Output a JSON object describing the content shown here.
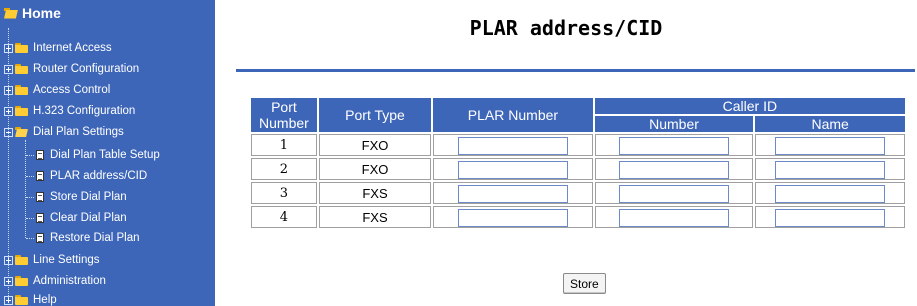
{
  "sidebar": {
    "home_label": "Home",
    "items": [
      {
        "label": "Internet Access"
      },
      {
        "label": "Router Configuration"
      },
      {
        "label": "Access Control"
      },
      {
        "label": "H.323 Configuration"
      },
      {
        "label": "Dial Plan Settings"
      },
      {
        "label": "Dial Plan Table Setup"
      },
      {
        "label": "PLAR address/CID"
      },
      {
        "label": "Store Dial Plan"
      },
      {
        "label": "Clear Dial Plan"
      },
      {
        "label": "Restore Dial Plan"
      },
      {
        "label": "Line Settings"
      },
      {
        "label": "Administration"
      },
      {
        "label": "Help"
      }
    ]
  },
  "main": {
    "title": "PLAR address/CID",
    "table": {
      "headers": {
        "port_line1": "Port",
        "port_line2": "Number",
        "port_type": "Port Type",
        "plar_number": "PLAR Number",
        "caller_id": "Caller ID",
        "cid_number": "Number",
        "cid_name": "Name"
      },
      "rows": [
        {
          "port": "1",
          "type": "FXO",
          "plar": "",
          "cid_number": "",
          "cid_name": ""
        },
        {
          "port": "2",
          "type": "FXO",
          "plar": "",
          "cid_number": "",
          "cid_name": ""
        },
        {
          "port": "3",
          "type": "FXS",
          "plar": "",
          "cid_number": "",
          "cid_name": ""
        },
        {
          "port": "4",
          "type": "FXS",
          "plar": "",
          "cid_number": "",
          "cid_name": ""
        }
      ]
    },
    "store_label": "Store"
  },
  "colors": {
    "sidebar_bg": "#3e66b8",
    "header_bg": "#3e66b8",
    "folder": "#ffcc33"
  }
}
